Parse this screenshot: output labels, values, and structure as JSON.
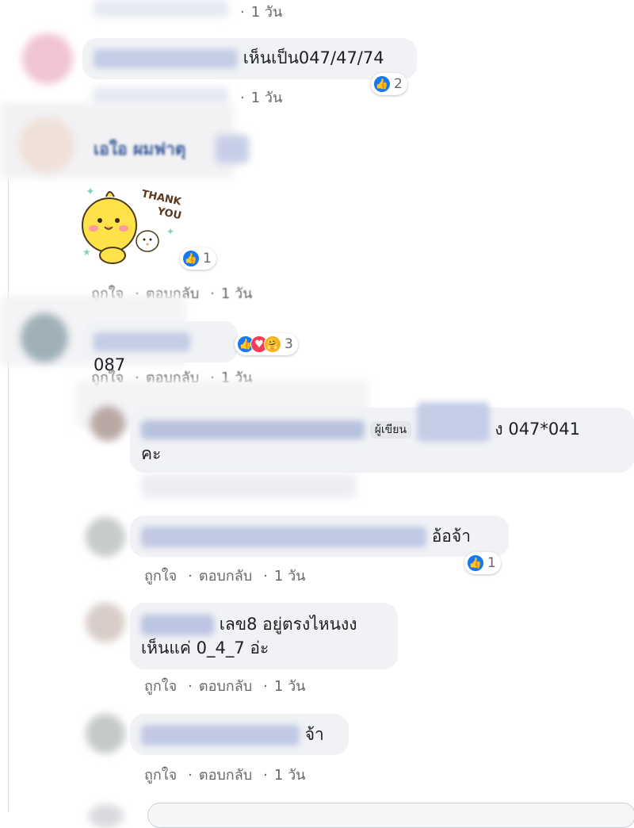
{
  "actions": {
    "like": "ถูกใจ",
    "reply": "ตอบกลับ",
    "separator": "·"
  },
  "time_label": "1 วัน",
  "comments": [
    {
      "text": "เห็นเป็น047/47/74",
      "reaction_count": "2"
    },
    {
      "name_partial": "เอใอ ผมฟาตุ",
      "sticker_text": "THANK YOU",
      "reaction_count": "1"
    },
    {
      "text": "087",
      "reaction_count": "3"
    },
    {
      "author_badge": "ผู้เขียน",
      "text_partial": "ง 047*041",
      "text_line2": "คะ"
    },
    {
      "text": "อ้อจ้า",
      "reaction_count": "1"
    },
    {
      "text_line1": "เลข8 อยู่ตรงไหนงง",
      "text_line2": "เห็นแค่ 0_4_7 อ่ะ"
    },
    {
      "text": "จ้า"
    }
  ],
  "colors": {
    "like_blue": "#1877f2",
    "love_red": "#f33e58",
    "care_yellow": "#f7b125",
    "bubble_bg": "#f0f2f5",
    "meta_gray": "#65676b"
  }
}
